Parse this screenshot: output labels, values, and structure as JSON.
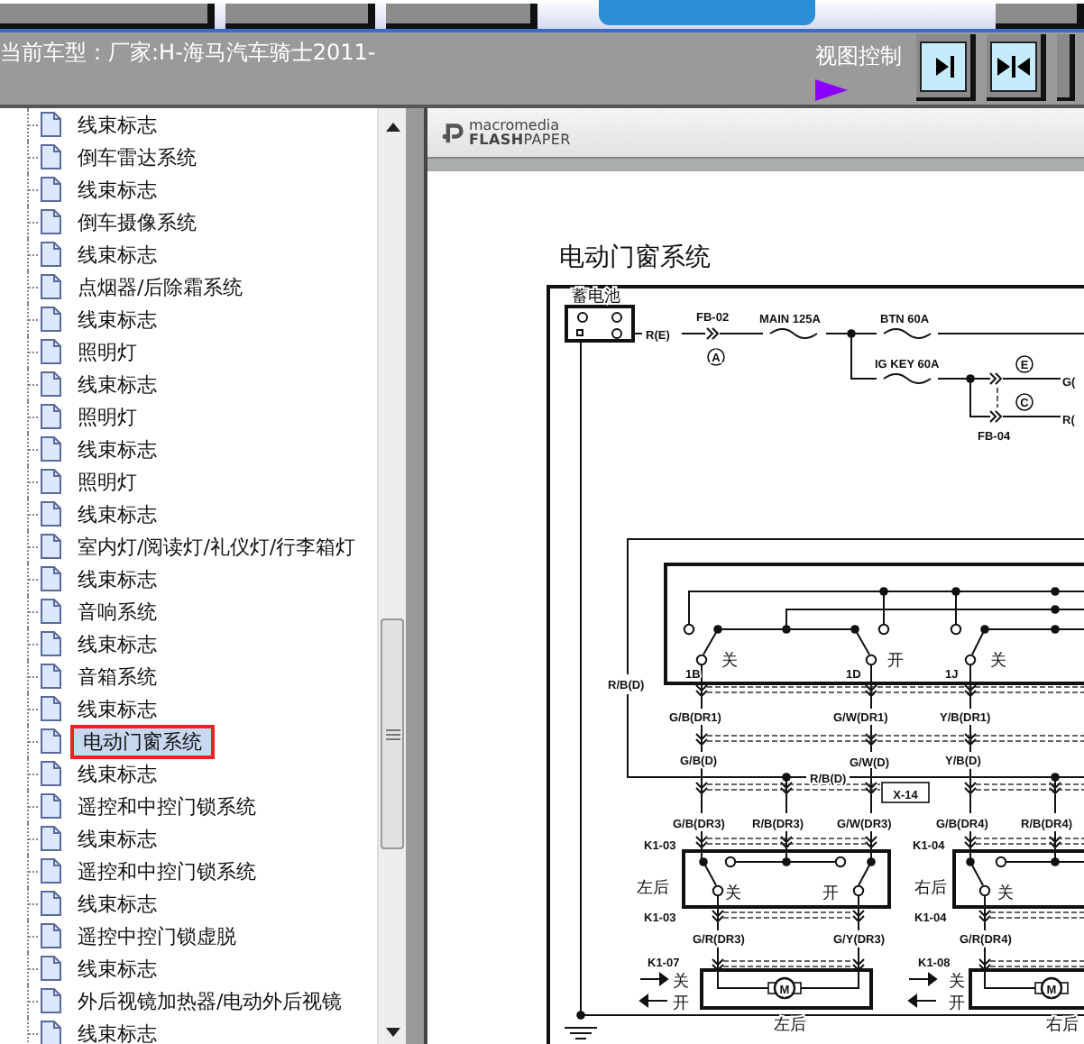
{
  "nav_buttons": [
    {
      "kind": "plain"
    },
    {
      "kind": "plain"
    },
    {
      "kind": "plain"
    },
    {
      "kind": "tab"
    },
    {
      "kind": "plain"
    }
  ],
  "header": {
    "vehicle": "当前车型：厂家:H-海马汽车骑士2011-",
    "view_control": "视图控制"
  },
  "view_buttons": [
    {
      "kind": "dock-right"
    },
    {
      "kind": "split"
    },
    {
      "kind": "partial"
    }
  ],
  "tree": {
    "items": [
      {
        "label": "线束标志",
        "selected": false
      },
      {
        "label": "倒车雷达系统",
        "selected": false
      },
      {
        "label": "线束标志",
        "selected": false
      },
      {
        "label": "倒车摄像系统",
        "selected": false
      },
      {
        "label": "线束标志",
        "selected": false
      },
      {
        "label": "点烟器/后除霜系统",
        "selected": false
      },
      {
        "label": "线束标志",
        "selected": false
      },
      {
        "label": "照明灯",
        "selected": false
      },
      {
        "label": "线束标志",
        "selected": false
      },
      {
        "label": "照明灯",
        "selected": false
      },
      {
        "label": "线束标志",
        "selected": false
      },
      {
        "label": "照明灯",
        "selected": false
      },
      {
        "label": "线束标志",
        "selected": false
      },
      {
        "label": "室内灯/阅读灯/礼仪灯/行李箱灯",
        "selected": false
      },
      {
        "label": "线束标志",
        "selected": false
      },
      {
        "label": "音响系统",
        "selected": false
      },
      {
        "label": "线束标志",
        "selected": false
      },
      {
        "label": "音箱系统",
        "selected": false
      },
      {
        "label": "线束标志",
        "selected": false
      },
      {
        "label": "电动门窗系统",
        "selected": true
      },
      {
        "label": "线束标志",
        "selected": false
      },
      {
        "label": "遥控和中控门锁系统",
        "selected": false
      },
      {
        "label": "线束标志",
        "selected": false
      },
      {
        "label": "遥控和中控门锁系统",
        "selected": false
      },
      {
        "label": "线束标志",
        "selected": false
      },
      {
        "label": "遥控中控门锁虚脱",
        "selected": false
      },
      {
        "label": "线束标志",
        "selected": false
      },
      {
        "label": "外后视镜加热器/电动外后视镜",
        "selected": false
      },
      {
        "label": "线束标志",
        "selected": false
      }
    ]
  },
  "viewer": {
    "brand_top": "macromedia",
    "brand_bold": "FLASH",
    "brand_rest": "PAPER",
    "title": "电动门窗系统",
    "labels": [
      {
        "kind": "caption",
        "text": "蓄电池"
      },
      {
        "kind": "wire",
        "text": "FB-02"
      },
      {
        "kind": "wire",
        "text": "R(E)"
      },
      {
        "kind": "wire",
        "text": "MAIN 125A"
      },
      {
        "kind": "wire",
        "text": "BTN 60A"
      },
      {
        "kind": "wire",
        "text": "IG KEY 60A"
      },
      {
        "kind": "wire",
        "text": "G("
      },
      {
        "kind": "wire",
        "text": "R("
      },
      {
        "kind": "circled",
        "text": "A"
      },
      {
        "kind": "circled",
        "text": "E"
      },
      {
        "kind": "circled",
        "text": "C"
      },
      {
        "kind": "wire",
        "text": "FB-04"
      },
      {
        "kind": "caption",
        "text": "关"
      },
      {
        "kind": "caption",
        "text": "开"
      },
      {
        "kind": "caption",
        "text": "关"
      },
      {
        "kind": "wire",
        "text": "1B"
      },
      {
        "kind": "wire",
        "text": "1D"
      },
      {
        "kind": "wire",
        "text": "1J"
      },
      {
        "kind": "wire",
        "text": "R/B(D)"
      },
      {
        "kind": "wire",
        "text": "G/B(DR1)"
      },
      {
        "kind": "wire",
        "text": "G/W(DR1)"
      },
      {
        "kind": "wire",
        "text": "Y/B(DR1)"
      },
      {
        "kind": "wire",
        "text": "G/B(D)"
      },
      {
        "kind": "wire",
        "text": "G/W(D)"
      },
      {
        "kind": "wire",
        "text": "Y/B(D)"
      },
      {
        "kind": "wire",
        "text": "R/B(D)"
      },
      {
        "kind": "boxed",
        "text": "X-14"
      },
      {
        "kind": "wire",
        "text": "G/B(DR3)"
      },
      {
        "kind": "wire",
        "text": "R/B(DR3)"
      },
      {
        "kind": "wire",
        "text": "G/W(DR3)"
      },
      {
        "kind": "wire",
        "text": "G/B(DR4)"
      },
      {
        "kind": "wire",
        "text": "R/B(DR4)"
      },
      {
        "kind": "wire",
        "text": "K1-03"
      },
      {
        "kind": "wire",
        "text": "K1-04"
      },
      {
        "kind": "caption",
        "text": "左后"
      },
      {
        "kind": "caption",
        "text": "关"
      },
      {
        "kind": "caption",
        "text": "开"
      },
      {
        "kind": "caption",
        "text": "右后"
      },
      {
        "kind": "caption",
        "text": "关"
      },
      {
        "kind": "wire",
        "text": "K1-03"
      },
      {
        "kind": "wire",
        "text": "K1-04"
      },
      {
        "kind": "wire",
        "text": "G/R(DR3)"
      },
      {
        "kind": "wire",
        "text": "G/Y(DR3)"
      },
      {
        "kind": "wire",
        "text": "G/R(DR4)"
      },
      {
        "kind": "wire",
        "text": "K1-07"
      },
      {
        "kind": "wire",
        "text": "K1-08"
      },
      {
        "kind": "caption",
        "text": "关"
      },
      {
        "kind": "caption",
        "text": "开"
      },
      {
        "kind": "caption",
        "text": "关"
      },
      {
        "kind": "caption",
        "text": "开"
      },
      {
        "kind": "motor",
        "text": "M"
      },
      {
        "kind": "motor",
        "text": "M"
      },
      {
        "kind": "caption",
        "text": "左后"
      },
      {
        "kind": "caption",
        "text": "右后"
      }
    ]
  }
}
